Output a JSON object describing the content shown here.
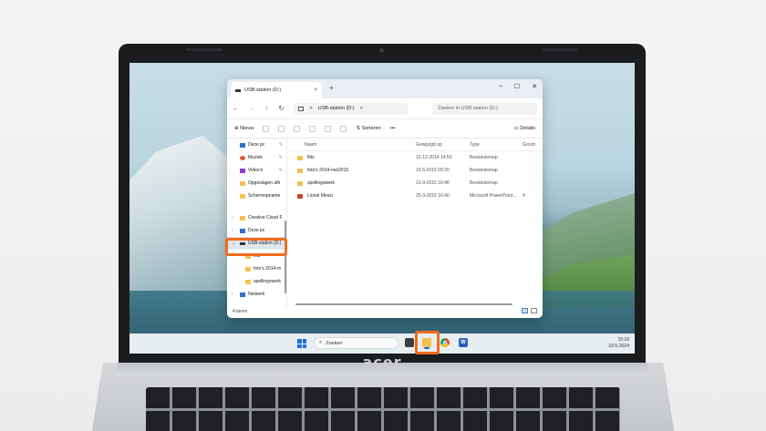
{
  "brand": "acer",
  "colors": {
    "highlight": "#f26c1b",
    "accent": "#1f6fd6",
    "folder": "#f2c14e"
  },
  "window": {
    "tab_title": "USB-station (D:)",
    "tab_close": "×",
    "new_tab": "+",
    "controls": {
      "minimize": "–",
      "maximize": "☐",
      "close": "✕"
    },
    "nav": {
      "back": "←",
      "forward": "→",
      "up": "↑",
      "refresh": "↻"
    },
    "address": "USB-station (D:)",
    "address_chevron": ">",
    "search_placeholder": "Zoeken in USB-station (D:)",
    "toolbar": {
      "new": "Nieuw",
      "sort": "Sorteren",
      "more": "•••",
      "details": "Details"
    },
    "sidebar": [
      {
        "label": "Deze pc",
        "icon": "monitor-icon",
        "pinned": true
      },
      {
        "label": "Muziek",
        "icon": "music-icon",
        "pinned": true
      },
      {
        "label": "Video's",
        "icon": "video-icon",
        "pinned": true
      },
      {
        "label": "Opgeslagen afb",
        "icon": "folder-icon",
        "pinned": false
      },
      {
        "label": "Schermopname",
        "icon": "folder-icon",
        "pinned": false
      },
      {
        "label": "Creative Cloud F",
        "icon": "folder-icon",
        "pinned": false
      },
      {
        "label": "Deze pc",
        "icon": "monitor-icon",
        "pinned": false
      },
      {
        "label": "USB-station (D:)",
        "icon": "drive-icon",
        "pinned": false,
        "selected": true
      },
      {
        "label": "fiits",
        "icon": "folder-icon"
      },
      {
        "label": "foto's 2014-m",
        "icon": "folder-icon"
      },
      {
        "label": "spellingswerk",
        "icon": "folder-icon"
      },
      {
        "label": "Netwerk",
        "icon": "network-icon"
      }
    ],
    "columns": {
      "name": "Naam",
      "date": "Gewijzigd op",
      "type": "Type",
      "size": "Groott"
    },
    "files": [
      {
        "name": "fiits",
        "date": "12-12-2014 14:50",
        "type": "Bestandsmap",
        "size": "",
        "icon": "folder-icon"
      },
      {
        "name": "foto's 2014-mei2015",
        "date": "15-5-2015 09:30",
        "type": "Bestandsmap",
        "size": "",
        "icon": "folder-icon"
      },
      {
        "name": "spellingswerk",
        "date": "12-9-2015 16:48",
        "type": "Bestandsmap",
        "size": "",
        "icon": "folder-icon"
      },
      {
        "name": "Lionel Messi",
        "date": "25-3-2015 16:40",
        "type": "Microsoft PowerPoint...",
        "size": "4",
        "icon": "powerpoint-icon"
      }
    ],
    "status": "4 items"
  },
  "taskbar": {
    "search_label": "Zoeken",
    "time": "15:16",
    "date": "23-5-2024"
  }
}
